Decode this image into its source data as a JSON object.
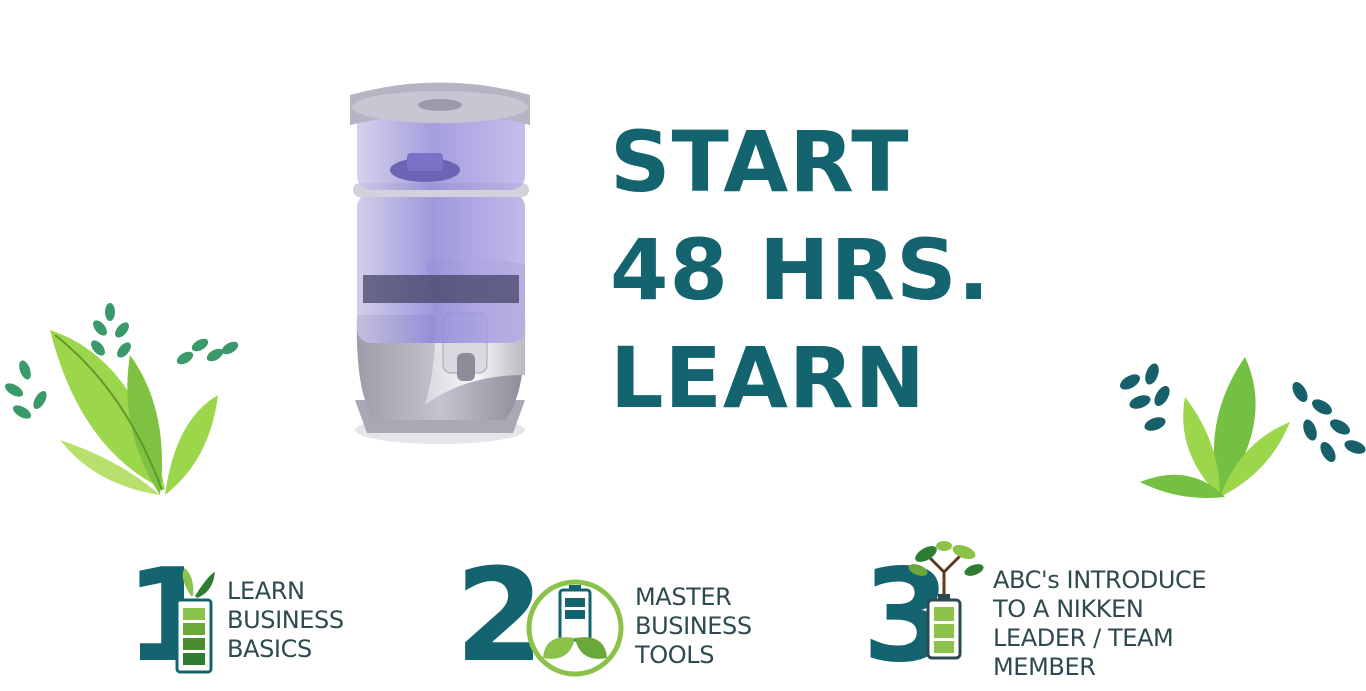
{
  "headline": {
    "line1": "START",
    "line2": "48 HRS.",
    "line3": "LEARN"
  },
  "steps": [
    {
      "number": "1",
      "lines": [
        "LEARN",
        "BUSINESS",
        "BASICS"
      ],
      "icon": "battery-plant-icon"
    },
    {
      "number": "2",
      "lines": [
        "MASTER",
        "BUSINESS",
        "TOOLS"
      ],
      "icon": "battery-leaf-badge-icon"
    },
    {
      "number": "3",
      "lines": [
        "ABC's INTRODUCE",
        "TO A NIKKEN",
        "LEADER / TEAM",
        "MEMBER"
      ],
      "icon": "battery-tree-icon"
    }
  ],
  "colors": {
    "teal": "#13646e",
    "green": "#8bc34a",
    "lime": "#b7e06d",
    "dark_green": "#2e7d32",
    "text": "#2f4a4e"
  }
}
